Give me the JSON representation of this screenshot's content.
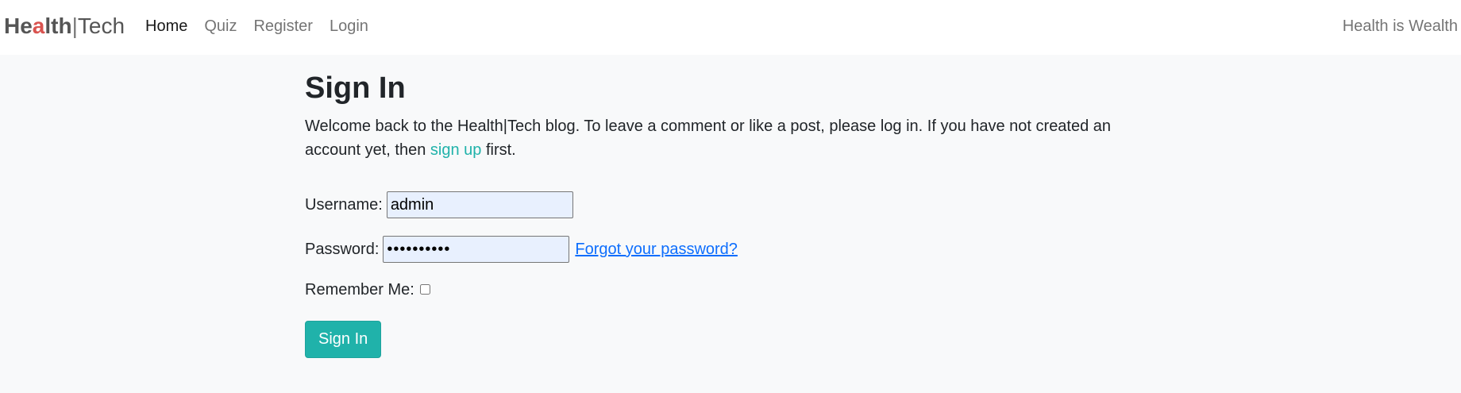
{
  "brand": {
    "part1": "He",
    "accent": "a",
    "part2": "lth",
    "separator": "|",
    "part3": "Tech"
  },
  "nav": {
    "items": [
      {
        "label": "Home",
        "active": true
      },
      {
        "label": "Quiz",
        "active": false
      },
      {
        "label": "Register",
        "active": false
      },
      {
        "label": "Login",
        "active": false
      }
    ],
    "tagline": "Health is Wealth"
  },
  "main": {
    "title": "Sign In",
    "intro_before": "Welcome back to the Health|Tech blog. To leave a comment or like a post, please log in. If you have not created an account yet, then ",
    "intro_link": "sign up",
    "intro_after": " first."
  },
  "form": {
    "username_label": "Username:",
    "username_value": "admin",
    "password_label": "Password:",
    "password_value": "••••••••••",
    "forgot_label": "Forgot your password?",
    "remember_label": "Remember Me:",
    "remember_checked": false,
    "submit_label": "Sign In"
  },
  "colors": {
    "accent": "#20b2aa",
    "link": "#0d6efd",
    "brand_accent": "#d9534f",
    "background": "#f8f9fa"
  }
}
